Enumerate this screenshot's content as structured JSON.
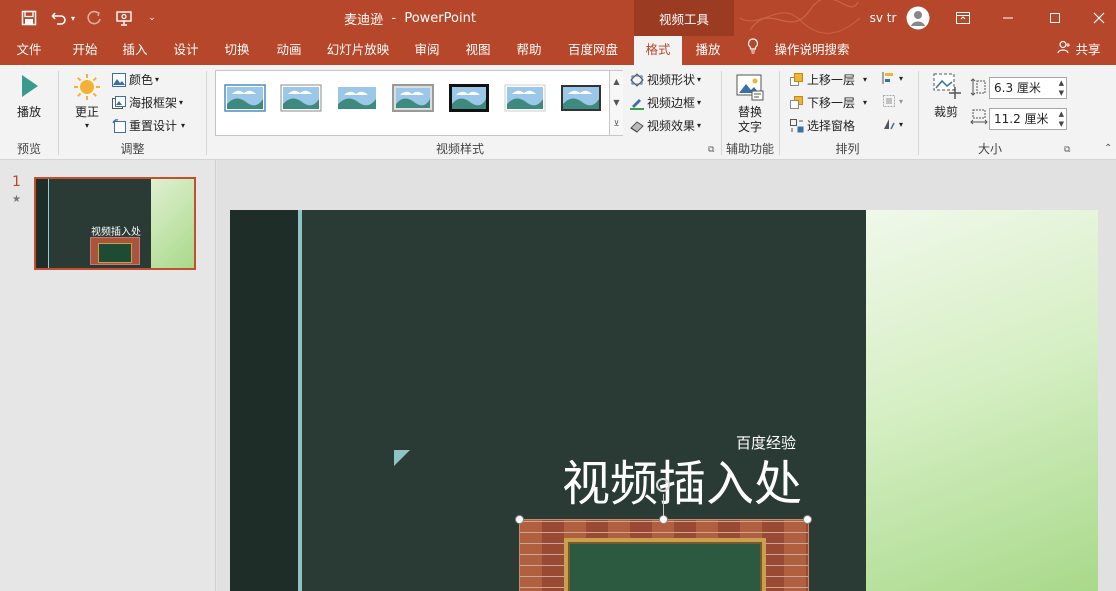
{
  "window": {
    "doc_title": "麦迪逊",
    "separator": "-",
    "app_name": "PowerPoint",
    "context_tab_group": "视频工具",
    "user_name": "sv tr"
  },
  "tabs": [
    "文件",
    "开始",
    "插入",
    "设计",
    "切换",
    "动画",
    "幻灯片放映",
    "审阅",
    "视图",
    "帮助",
    "百度网盘",
    "格式",
    "播放"
  ],
  "active_tab": "格式",
  "tell_me": "操作说明搜索",
  "share": "共享",
  "ribbon": {
    "preview": {
      "play": "播放",
      "group": "预览"
    },
    "adjust": {
      "corrections": "更正",
      "color": "颜色",
      "poster_frame": "海报框架",
      "reset_design": "重置设计",
      "group": "调整"
    },
    "video_styles": {
      "shape": "视频形状",
      "border": "视频边框",
      "effects": "视频效果",
      "group": "视频样式"
    },
    "accessibility": {
      "alt_text_l1": "替换",
      "alt_text_l2": "文字",
      "group": "辅助功能"
    },
    "arrange": {
      "bring_forward": "上移一层",
      "send_backward": "下移一层",
      "selection_pane": "选择窗格",
      "group": "排列"
    },
    "size": {
      "crop": "裁剪",
      "height": "6.3 厘米",
      "width": "11.2 厘米",
      "group": "大小"
    }
  },
  "thumbnails": {
    "slide_number": "1",
    "star": "★",
    "title": "视频插入处"
  },
  "slide": {
    "subtitle": "百度经验",
    "title": "视频插入处"
  },
  "colors": {
    "accent": "#b7472a",
    "slide_bg": "#2a3b35",
    "ribbon_bg": "#f3f3f3"
  }
}
